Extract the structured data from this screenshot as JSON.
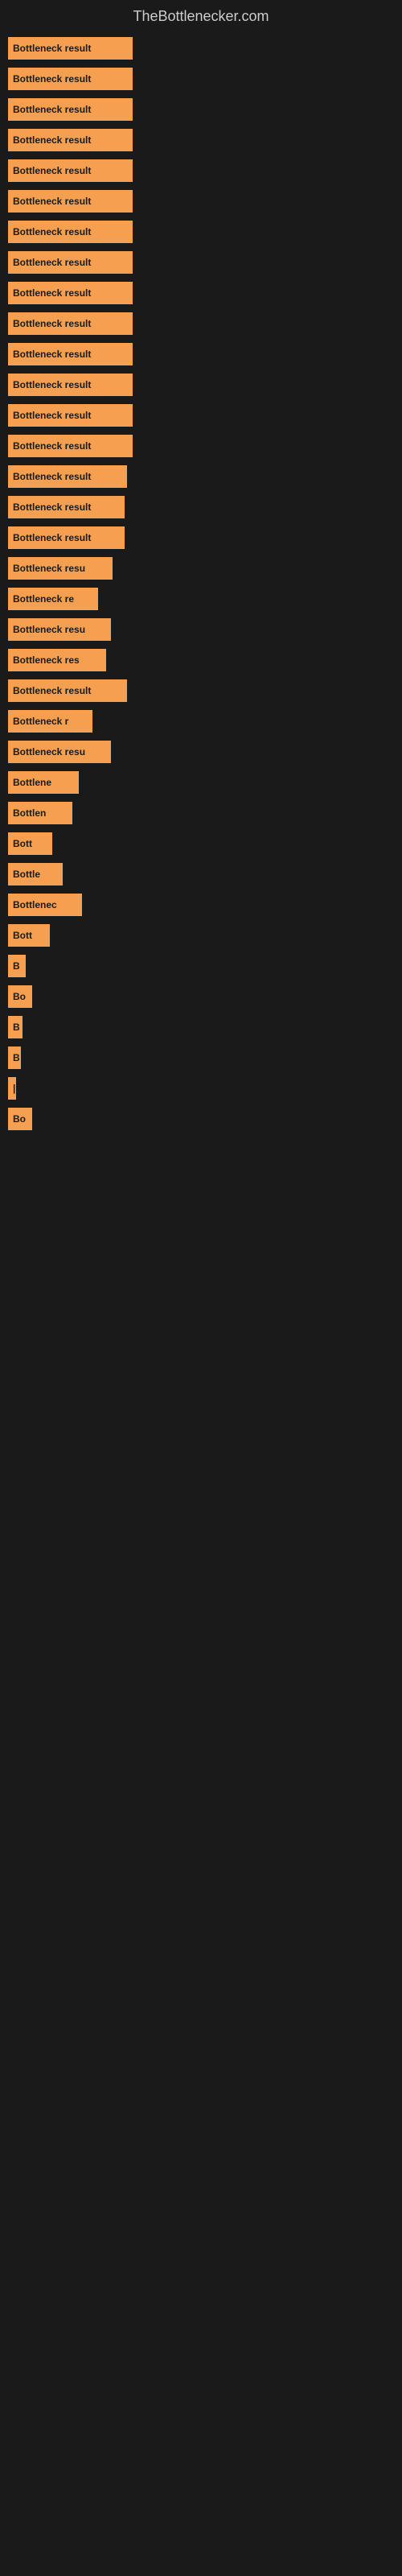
{
  "site": {
    "title": "TheBottlenecker.com"
  },
  "bars": [
    {
      "label": "Bottleneck result",
      "width": 155
    },
    {
      "label": "Bottleneck result",
      "width": 155
    },
    {
      "label": "Bottleneck result",
      "width": 155
    },
    {
      "label": "Bottleneck result",
      "width": 155
    },
    {
      "label": "Bottleneck result",
      "width": 155
    },
    {
      "label": "Bottleneck result",
      "width": 155
    },
    {
      "label": "Bottleneck result",
      "width": 155
    },
    {
      "label": "Bottleneck result",
      "width": 155
    },
    {
      "label": "Bottleneck result",
      "width": 155
    },
    {
      "label": "Bottleneck result",
      "width": 155
    },
    {
      "label": "Bottleneck result",
      "width": 155
    },
    {
      "label": "Bottleneck result",
      "width": 155
    },
    {
      "label": "Bottleneck result",
      "width": 155
    },
    {
      "label": "Bottleneck result",
      "width": 155
    },
    {
      "label": "Bottleneck result",
      "width": 148
    },
    {
      "label": "Bottleneck result",
      "width": 145
    },
    {
      "label": "Bottleneck result",
      "width": 145
    },
    {
      "label": "Bottleneck resu",
      "width": 130
    },
    {
      "label": "Bottleneck re",
      "width": 112
    },
    {
      "label": "Bottleneck resu",
      "width": 128
    },
    {
      "label": "Bottleneck res",
      "width": 122
    },
    {
      "label": "Bottleneck result",
      "width": 148
    },
    {
      "label": "Bottleneck r",
      "width": 105
    },
    {
      "label": "Bottleneck resu",
      "width": 128
    },
    {
      "label": "Bottlene",
      "width": 88
    },
    {
      "label": "Bottlen",
      "width": 80
    },
    {
      "label": "Bott",
      "width": 55
    },
    {
      "label": "Bottle",
      "width": 68
    },
    {
      "label": "Bottlenec",
      "width": 92
    },
    {
      "label": "Bott",
      "width": 52
    },
    {
      "label": "B",
      "width": 22
    },
    {
      "label": "Bo",
      "width": 30
    },
    {
      "label": "B",
      "width": 18
    },
    {
      "label": "B",
      "width": 16
    },
    {
      "label": "|",
      "width": 10
    },
    {
      "label": "Bo",
      "width": 30
    }
  ]
}
